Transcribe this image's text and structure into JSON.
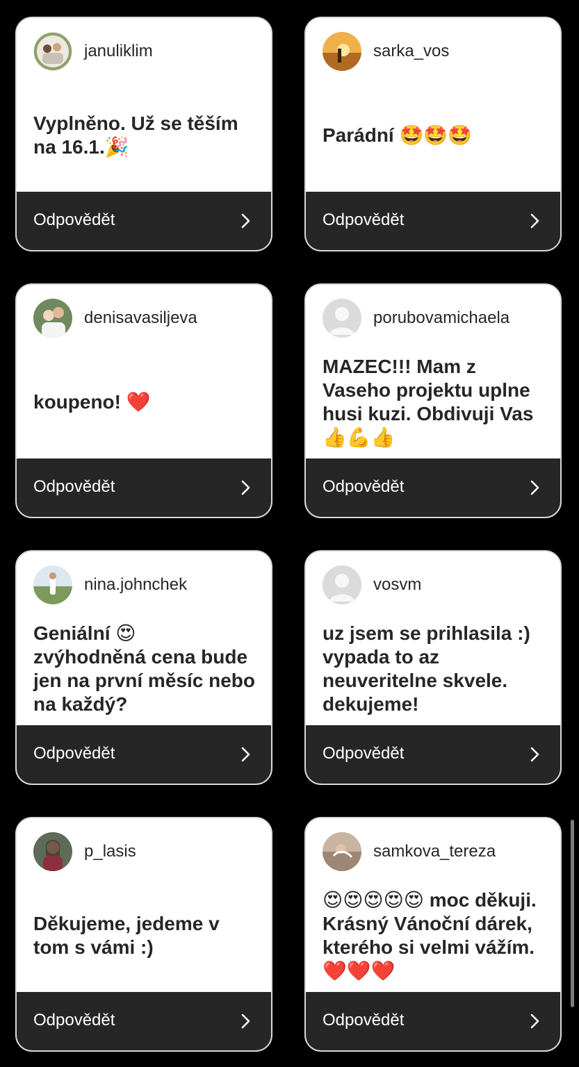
{
  "cards": [
    {
      "username": "januliklim",
      "message": "Vyplněno. Už se těším na 16.1.🎉",
      "reply_label": "Odpovědět",
      "avatar": "photo-avatar-family",
      "avatar_color": "#c8b8a6"
    },
    {
      "username": "sarka_vos",
      "message": "Parádní 🤩🤩🤩",
      "reply_label": "Odpovědět",
      "avatar": "photo-avatar-sunset",
      "avatar_color": "#e9a53c"
    },
    {
      "username": "denisavasiljeva",
      "message": "koupeno! ❤️",
      "reply_label": "Odpovědět",
      "avatar": "photo-avatar-couple",
      "avatar_color": "#6f8a5e"
    },
    {
      "username": "porubovamichaela",
      "message": "MAZEC!!! Mam z Vaseho projektu uplne husi kuzi. Obdivuji Vas 👍💪👍",
      "reply_label": "Odpovědět",
      "avatar": "default-user-avatar",
      "avatar_color": "#d6d6d6"
    },
    {
      "username": "nina.johnchek",
      "message": "Geniální 😍\nzvýhodněná cena bude jen na první měsíc nebo na každý?",
      "reply_label": "Odpovědět",
      "avatar": "photo-avatar-meadow",
      "avatar_color": "#7b9a5b"
    },
    {
      "username": "vosvm",
      "message": "uz jsem se prihlasila :) vypada to az neuveritelne skvele. dekujeme!",
      "reply_label": "Odpovědět",
      "avatar": "default-user-avatar",
      "avatar_color": "#d6d6d6"
    },
    {
      "username": "p_lasis",
      "message": "Děkujeme, jedeme v tom s vámi :)",
      "reply_label": "Odpovědět",
      "avatar": "photo-avatar-portrait",
      "avatar_color": "#5d6b58"
    },
    {
      "username": "samkova_tereza",
      "message": "😍😍😍😍😍 moc děkuji. Krásný Vánoční dárek, kterého si velmi vážím.  ❤️❤️❤️",
      "reply_label": "Odpovědět",
      "avatar": "photo-avatar-water",
      "avatar_color": "#b49a86"
    }
  ],
  "colors": {
    "background": "#000000",
    "card": "#ffffff",
    "reply_bar": "#262626",
    "text": "#262626",
    "reply_text": "#ffffff"
  }
}
